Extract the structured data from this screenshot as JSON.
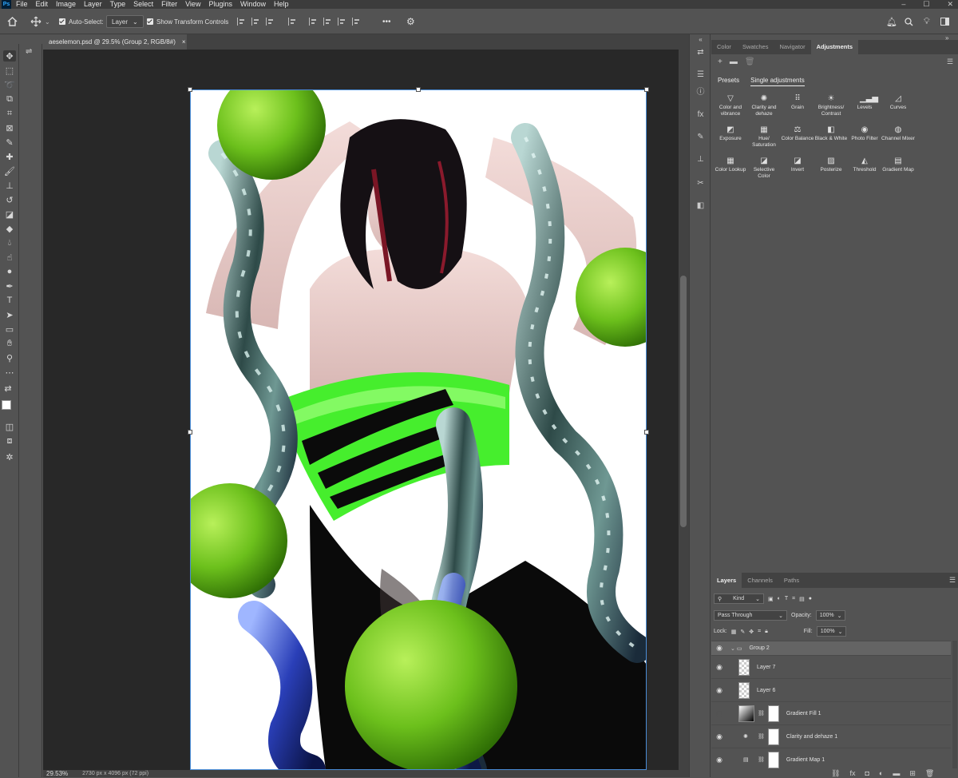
{
  "menubar": {
    "logo": "Ps",
    "items": [
      "File",
      "Edit",
      "Image",
      "Layer",
      "Type",
      "Select",
      "Filter",
      "View",
      "Plugins",
      "Window",
      "Help"
    ],
    "window_controls": [
      "–",
      "☐",
      "✕"
    ]
  },
  "options": {
    "auto_select_label": "Auto-Select:",
    "auto_select_target": "Layer",
    "show_transform_label": "Show Transform Controls",
    "more_label": "•••"
  },
  "document": {
    "tab_title": "aeselemon.psd @ 29.5% (Group 2, RGB/8#)",
    "tab_close": "×",
    "zoom": "29.53%",
    "doc_size": "2730 px x 4096 px (72 ppi)"
  },
  "adjustments": {
    "tabs": [
      "Color",
      "Swatches",
      "Navigator",
      "Adjustments"
    ],
    "active_tab": "Adjustments",
    "subtabs": [
      "Presets",
      "Single adjustments"
    ],
    "items": [
      {
        "label": "Color and vibrance",
        "icon": "color-vibrance-icon",
        "glyph": "▽"
      },
      {
        "label": "Clarity and dehaze",
        "icon": "clarity-icon",
        "glyph": "✺"
      },
      {
        "label": "Grain",
        "icon": "grain-icon",
        "glyph": "⠿"
      },
      {
        "label": "Brightness/ Contrast",
        "icon": "brightness-icon",
        "glyph": "☀"
      },
      {
        "label": "Levels",
        "icon": "levels-icon",
        "glyph": "▁▃▅"
      },
      {
        "label": "Curves",
        "icon": "curves-icon",
        "glyph": "◿"
      },
      {
        "label": "Exposure",
        "icon": "exposure-icon",
        "glyph": "◩"
      },
      {
        "label": "Hue/ Saturation",
        "icon": "hue-saturation-icon",
        "glyph": "▦"
      },
      {
        "label": "Color Balance",
        "icon": "color-balance-icon",
        "glyph": "⚖"
      },
      {
        "label": "Black & White",
        "icon": "black-white-icon",
        "glyph": "◧"
      },
      {
        "label": "Photo Filter",
        "icon": "photo-filter-icon",
        "glyph": "◉"
      },
      {
        "label": "Channel Mixer",
        "icon": "channel-mixer-icon",
        "glyph": "◍"
      },
      {
        "label": "Color Lookup",
        "icon": "color-lookup-icon",
        "glyph": "▦"
      },
      {
        "label": "Selective Color",
        "icon": "selective-color-icon",
        "glyph": "◪"
      },
      {
        "label": "Invert",
        "icon": "invert-icon",
        "glyph": "◪"
      },
      {
        "label": "Posterize",
        "icon": "posterize-icon",
        "glyph": "▨"
      },
      {
        "label": "Threshold",
        "icon": "threshold-icon",
        "glyph": "◭"
      },
      {
        "label": "Gradient Map",
        "icon": "gradient-map-icon",
        "glyph": "▤"
      }
    ]
  },
  "layers": {
    "tabs": [
      "Layers",
      "Channels",
      "Paths"
    ],
    "filter_kind": "Kind",
    "blend_mode": "Pass Through",
    "opacity_label": "Opacity:",
    "opacity_value": "100%",
    "lock_label": "Lock:",
    "fill_label": "Fill:",
    "fill_value": "100%",
    "rows": [
      {
        "name": "Group 2",
        "type": "group",
        "visible": true
      },
      {
        "name": "Layer 7",
        "type": "pixel",
        "visible": true
      },
      {
        "name": "Layer 6",
        "type": "pixel",
        "visible": true
      },
      {
        "name": "Gradient Fill 1",
        "type": "gradient-fill",
        "visible": false
      },
      {
        "name": "Clarity and dehaze 1",
        "type": "adjustment",
        "visible": true
      },
      {
        "name": "Gradient Map 1",
        "type": "adjustment",
        "visible": true
      }
    ]
  },
  "colors": {
    "lime": "#7ed321",
    "strap_green": "#4cff2a",
    "panel_bg": "#535353",
    "canvas_bg": "#282828"
  }
}
